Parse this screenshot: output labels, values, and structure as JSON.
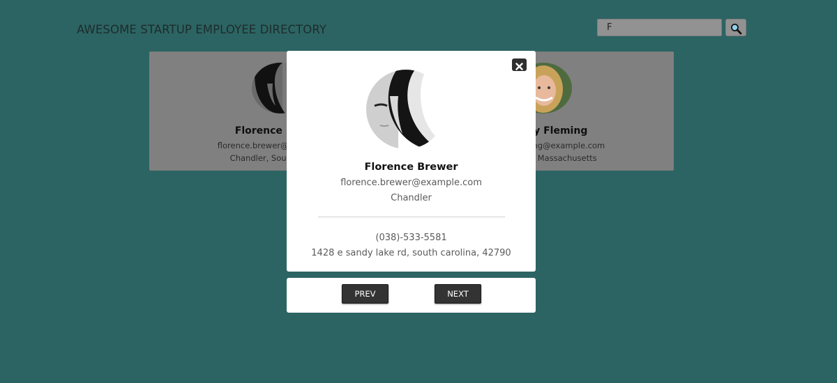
{
  "header": {
    "title": "AWESOME STARTUP EMPLOYEE DIRECTORY",
    "search_value": "F",
    "search_icon": "magnifier-icon"
  },
  "cards": [
    {
      "name": "Florence Brewer",
      "email": "florence.brewer@example.com",
      "location": "Chandler, South Carolina"
    },
    {
      "name": "Beverly Fleming",
      "email": "beverly.fleming@example.com",
      "location": "Centennial, Massachusetts"
    }
  ],
  "modal": {
    "close_icon": "close-icon",
    "name": "Florence Brewer",
    "email": "florence.brewer@example.com",
    "city": "Chandler",
    "phone": "(038)-533-5581",
    "address": "1428 e sandy lake rd, south carolina, 42790"
  },
  "navigation": {
    "prev_label": "PREV",
    "next_label": "NEXT"
  },
  "colors": {
    "background": "#2c6463",
    "card_dimmed": "#808080",
    "modal_background": "#ffffff",
    "button_dark": "#333333"
  }
}
